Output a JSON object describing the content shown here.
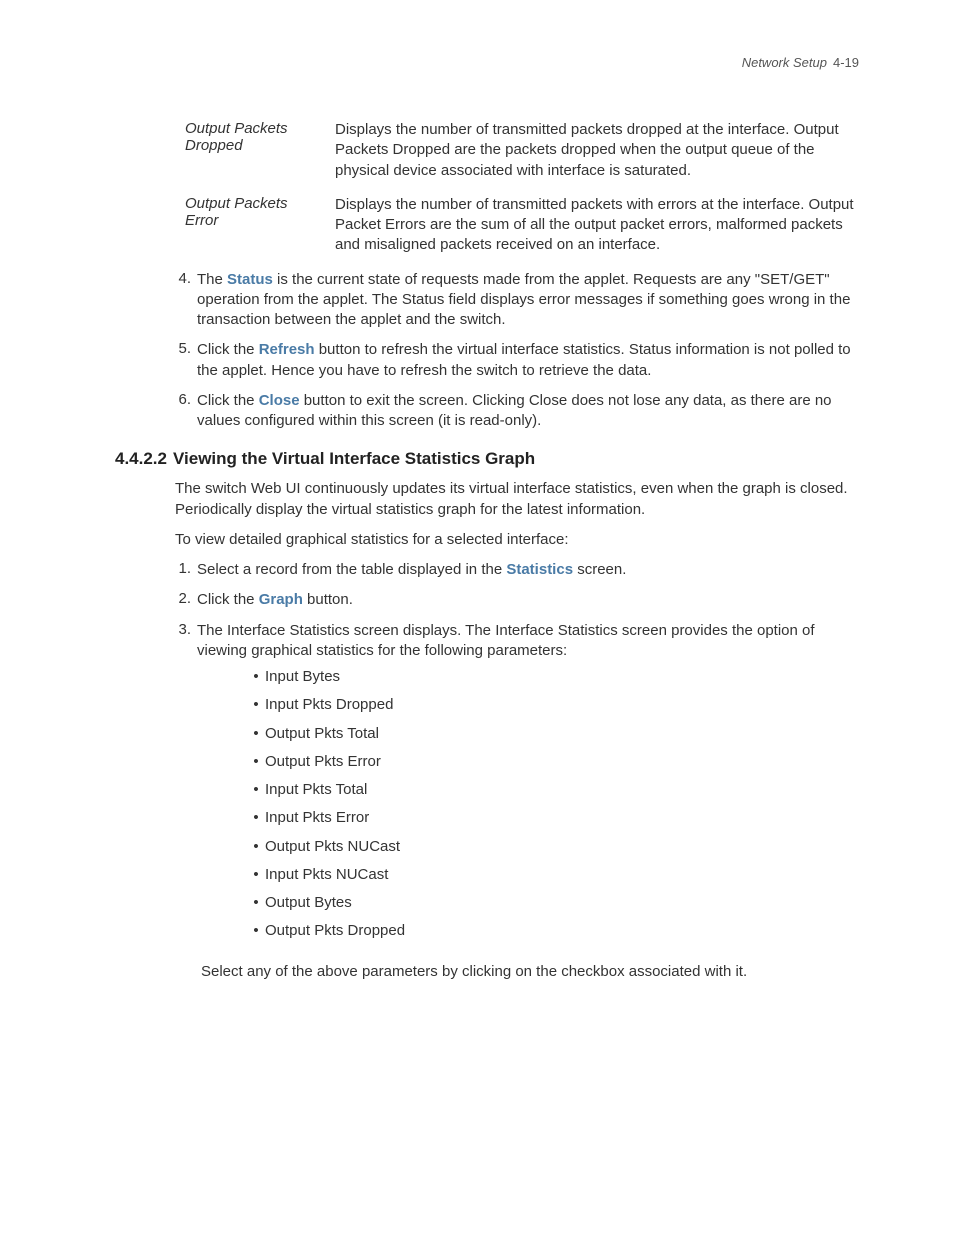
{
  "header": {
    "title": "Network Setup",
    "page": "4-19"
  },
  "defs": [
    {
      "term": "Output Packets Dropped",
      "desc": "Displays the number of transmitted packets dropped at the interface. Output Packets Dropped are the packets dropped when the output queue of the physical device associated with interface is saturated."
    },
    {
      "term": "Output Packets Error",
      "desc": "Displays the number of transmitted packets with errors at the interface. Output Packet Errors are the sum of all the output packet errors, malformed packets and misaligned packets received on an interface."
    }
  ],
  "steps_top": [
    {
      "num": "4.",
      "pre": "The ",
      "kw": "Status",
      "post": " is the current state of requests made from the applet. Requests are any \"SET/GET\" operation from the applet. The Status field displays error messages if something goes wrong in the transaction between the applet and the switch."
    },
    {
      "num": "5.",
      "pre": "Click the ",
      "kw": "Refresh",
      "post": " button to refresh the virtual interface statistics. Status information is not polled to the applet. Hence you have to refresh the switch to retrieve the data."
    },
    {
      "num": "6.",
      "pre": "Click the ",
      "kw": "Close",
      "post": " button to exit the screen. Clicking Close does not lose any data, as there are no values configured within this screen (it is read-only)."
    }
  ],
  "section": {
    "num": "4.4.2.2",
    "title": "Viewing the Virtual Interface Statistics Graph"
  },
  "intro1": "The switch Web UI continuously updates its virtual interface statistics, even when the graph is closed. Periodically display the virtual statistics graph for the latest information.",
  "intro2": "To view detailed graphical statistics for a selected interface:",
  "steps_bottom": [
    {
      "num": "1.",
      "pre": "Select a record from the table displayed in the ",
      "kw": "Statistics",
      "post": " screen."
    },
    {
      "num": "2.",
      "pre": "Click the ",
      "kw": "Graph",
      "post": " button."
    },
    {
      "num": "3.",
      "pre": "",
      "kw": "",
      "post": "The Interface Statistics screen displays. The Interface Statistics screen provides the option of viewing graphical statistics for the following parameters:"
    }
  ],
  "bullets": [
    "Input Bytes",
    "Input Pkts Dropped",
    "Output Pkts Total",
    "Output Pkts Error",
    "Input Pkts Total",
    "Input Pkts Error",
    "Output Pkts NUCast",
    "Input Pkts NUCast",
    "Output Bytes",
    "Output Pkts Dropped"
  ],
  "trailing": "Select any of the above parameters by clicking on the checkbox associated with it."
}
